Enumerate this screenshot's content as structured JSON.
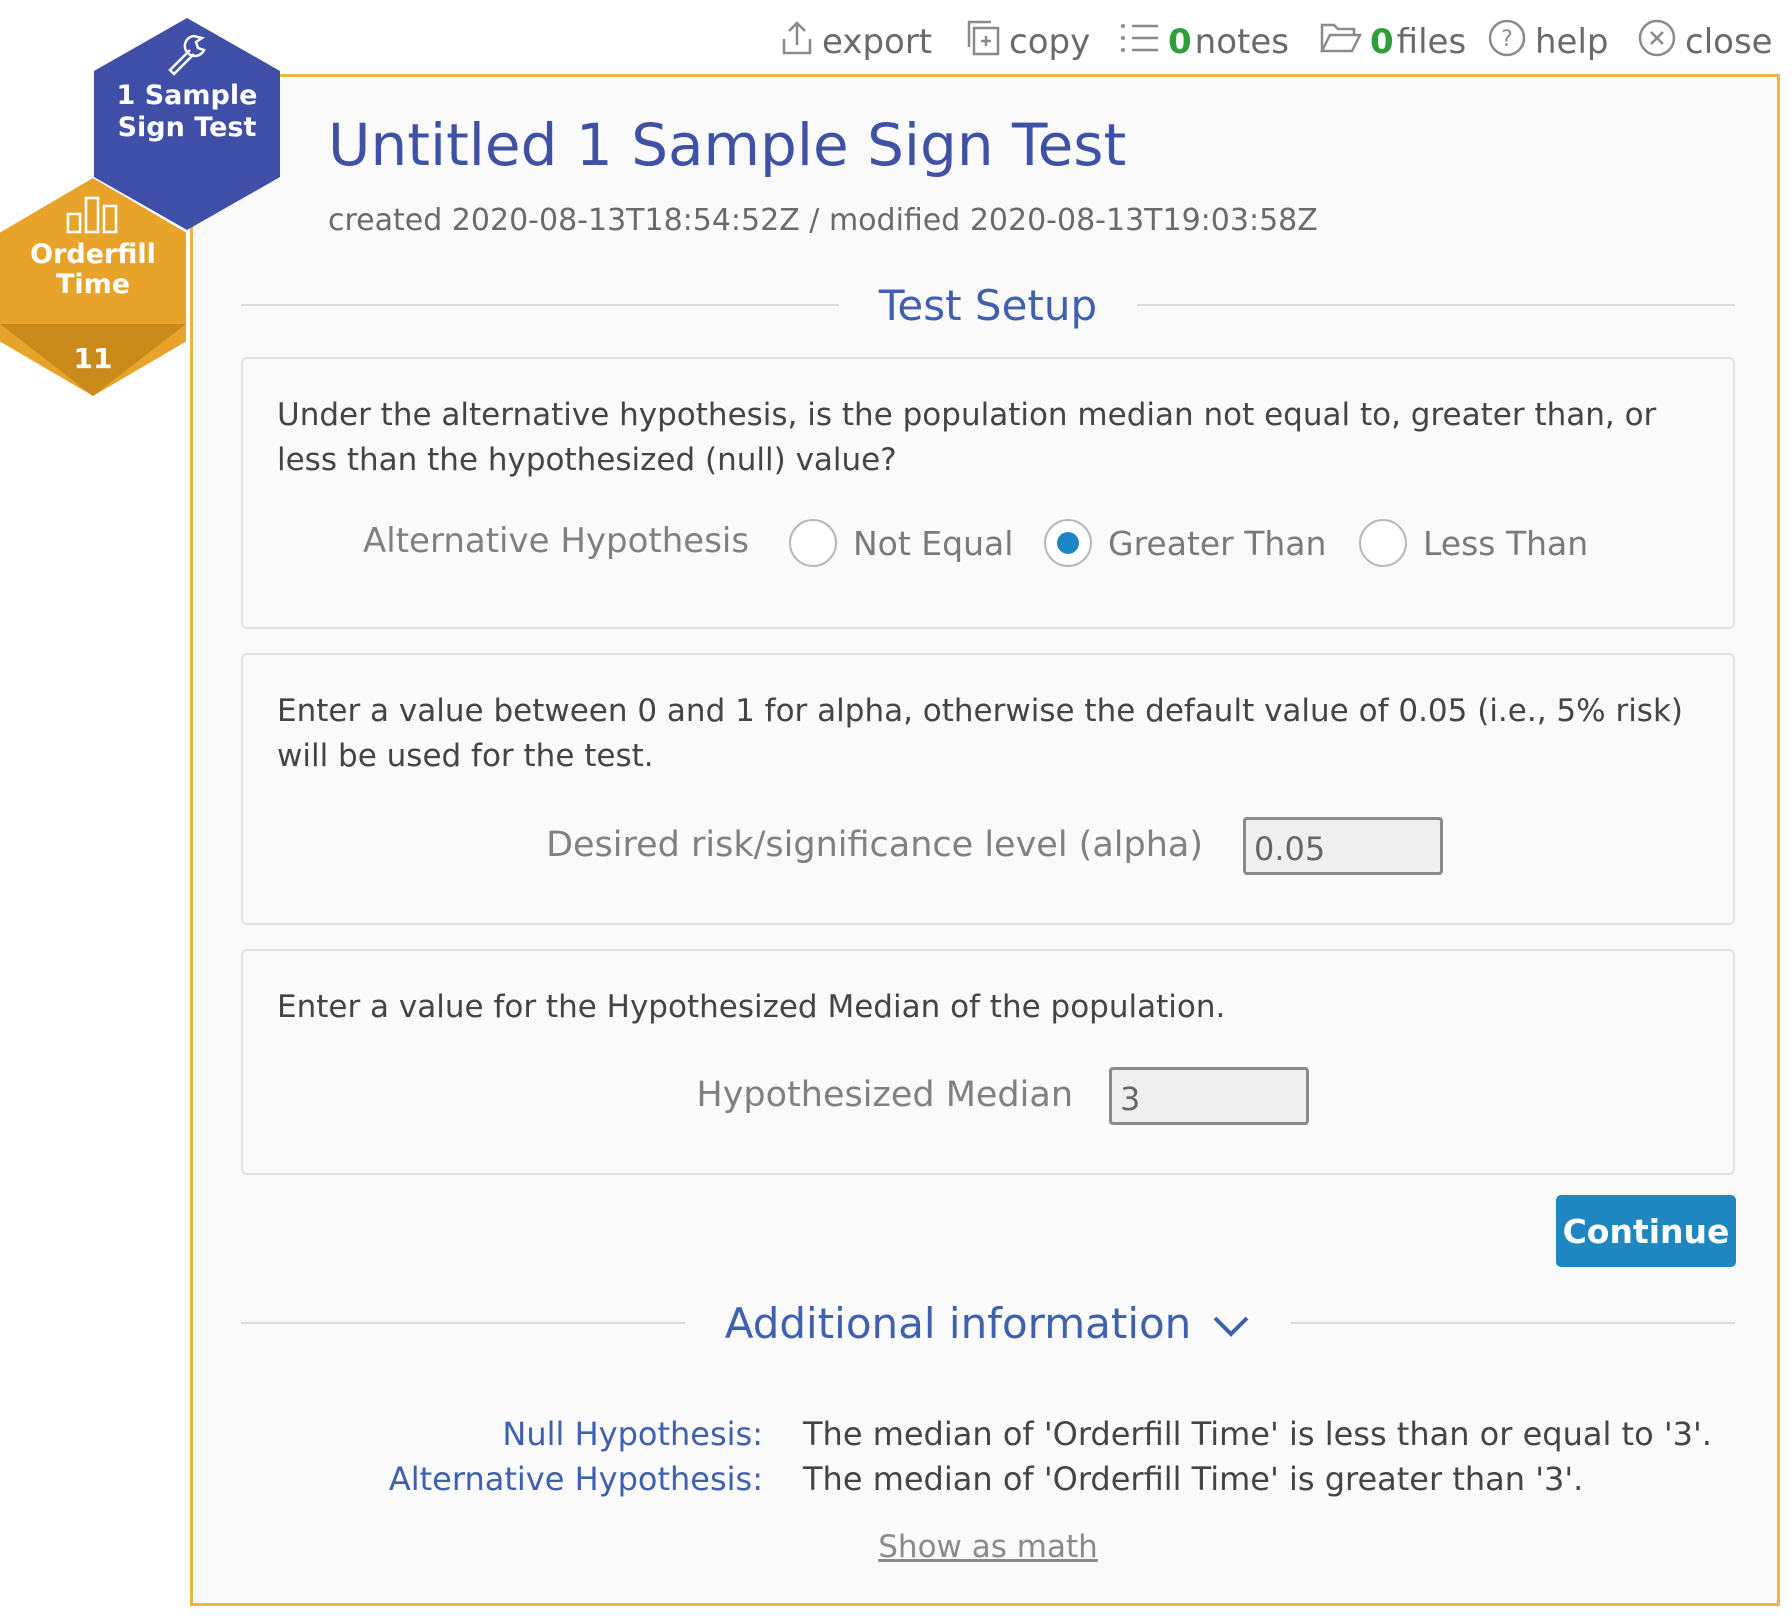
{
  "toolbar": {
    "export_label": "export",
    "copy_label": "copy",
    "notes_count": "0",
    "notes_label": "notes",
    "files_count": "0",
    "files_label": "files",
    "help_label": "help",
    "close_label": "close"
  },
  "badges": {
    "test_name": "1 Sample Sign Test",
    "variable_name": "Orderfill Time",
    "variable_count": "11",
    "test_color": "#3f4ea6",
    "variable_color": "#e8a42a"
  },
  "header": {
    "title": "Untitled 1 Sample Sign Test",
    "meta": "created 2020-08-13T18:54:52Z / modified 2020-08-13T19:03:58Z"
  },
  "test_setup": {
    "heading": "Test Setup",
    "hypothesis_card": {
      "text": "Under the alternative hypothesis, is the population median not equal to, greater than, or less than the hypothesized (null) value?",
      "label": "Alternative Hypothesis",
      "options": [
        "Not Equal",
        "Greater Than",
        "Less Than"
      ],
      "selected": "Greater Than"
    },
    "alpha_card": {
      "text": "Enter a value between 0 and 1 for alpha, otherwise the default value of 0.05 (i.e., 5% risk) will be used for the test.",
      "label": "Desired risk/significance level (alpha)",
      "value": "0.05"
    },
    "median_card": {
      "text": "Enter a value for the Hypothesized Median of the population.",
      "label": "Hypothesized Median",
      "value": "3"
    },
    "continue_label": "Continue"
  },
  "additional_info": {
    "heading": "Additional information",
    "null_label": "Null Hypothesis:",
    "null_text": "The median of 'Orderfill Time' is less than or equal to '3'.",
    "alt_label": "Alternative Hypothesis:",
    "alt_text": "The median of 'Orderfill Time' is greater than '3'.",
    "show_math_label": "Show as math"
  },
  "colors": {
    "accent": "#3f5fb0",
    "panel_border": "#f0b341",
    "button": "#1f87c0",
    "count": "#2e9e3a"
  }
}
